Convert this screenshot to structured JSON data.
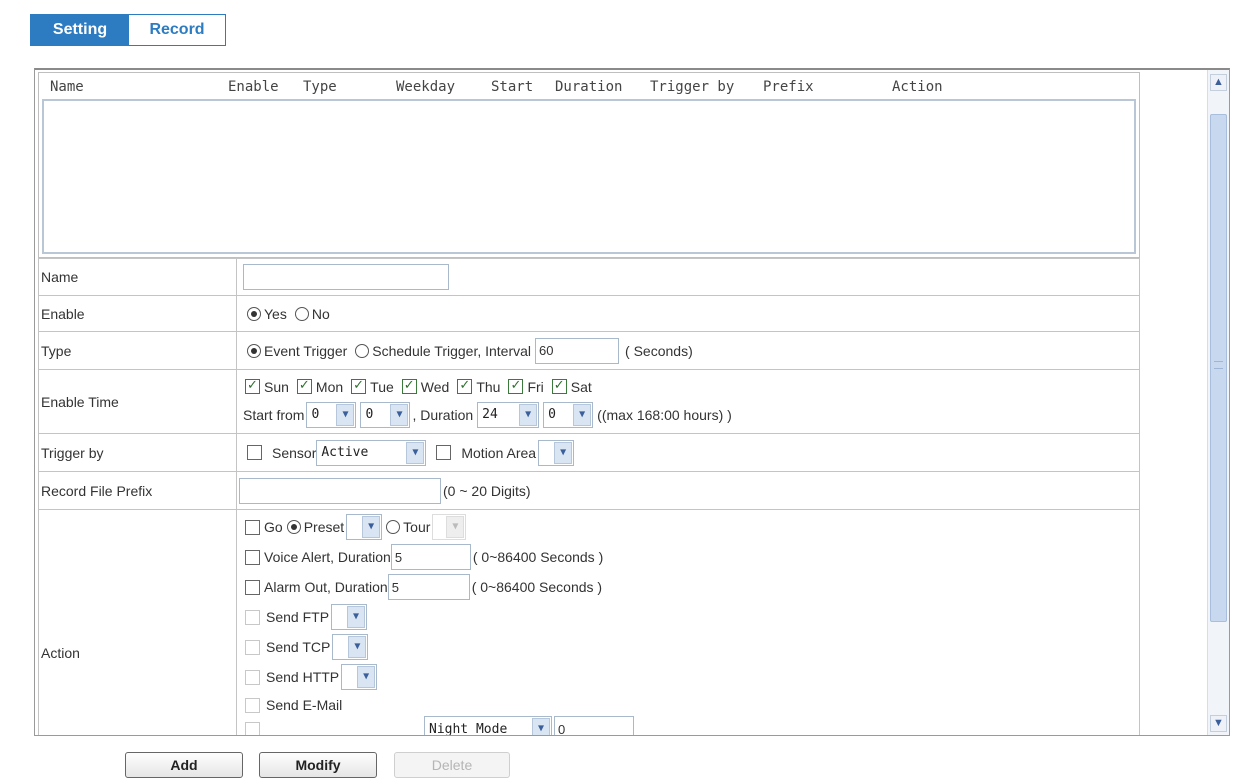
{
  "tabs": [
    {
      "label": "Setting"
    },
    {
      "label": "Record"
    }
  ],
  "list": {
    "columns": [
      "Name",
      "Enable",
      "Type",
      "Weekday",
      "Start",
      "Duration",
      "Trigger by",
      "Prefix",
      "Action"
    ]
  },
  "form": {
    "name": {
      "label": "Name",
      "value": ""
    },
    "enable": {
      "label": "Enable",
      "yes": "Yes",
      "no": "No",
      "selected": "Yes"
    },
    "type": {
      "label": "Type",
      "event": "Event Trigger",
      "schedule": "Schedule Trigger, Interval",
      "interval": "60",
      "unit": "( Seconds)",
      "selected": "Event Trigger"
    },
    "enable_time": {
      "label": "Enable Time",
      "days": [
        {
          "label": "Sun",
          "checked": true
        },
        {
          "label": "Mon",
          "checked": true
        },
        {
          "label": "Tue",
          "checked": true
        },
        {
          "label": "Wed",
          "checked": true
        },
        {
          "label": "Thu",
          "checked": true
        },
        {
          "label": "Fri",
          "checked": true
        },
        {
          "label": "Sat",
          "checked": true
        }
      ],
      "start_from": "Start from",
      "start_hour": "0",
      "start_min": "0",
      "duration_label": ", Duration",
      "duration_hour": "24",
      "duration_min": "0",
      "max_note": "((max 168:00 hours) )"
    },
    "trigger_by": {
      "label": "Trigger by",
      "sensor": "Sensor",
      "sensor_value": "Active",
      "motion": "Motion Area",
      "motion_value": ""
    },
    "prefix": {
      "label": "Record File Prefix",
      "value": "",
      "note": "(0 ~ 20 Digits)"
    },
    "action": {
      "label": "Action",
      "go": "Go",
      "preset": "Preset",
      "tour": "Tour",
      "voice": "Voice Alert, Duration",
      "voice_value": "5",
      "voice_note": "( 0~86400 Seconds )",
      "alarm": "Alarm Out, Duration",
      "alarm_value": "5",
      "alarm_note": "( 0~86400 Seconds )",
      "ftp": "Send FTP",
      "tcp": "Send TCP",
      "http": "Send HTTP",
      "email": "Send E-Mail",
      "partial_select": "Night Mode",
      "partial_value": "0"
    }
  },
  "buttons": {
    "add": "Add",
    "modify": "Modify",
    "delete": "Delete"
  },
  "colors": {
    "accent": "#2d7cc1",
    "check": "#2f6f2f"
  }
}
